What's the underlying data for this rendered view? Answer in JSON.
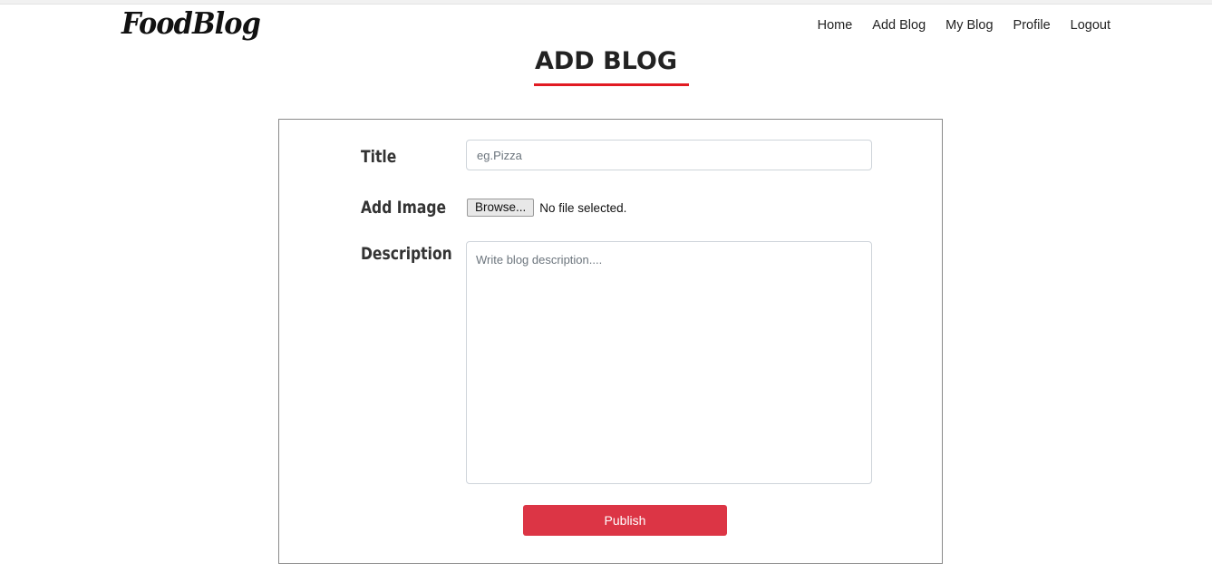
{
  "navbar": {
    "brand": "FoodBlog",
    "links": [
      "Home",
      "Add Blog",
      "My Blog",
      "Profile",
      "Logout"
    ]
  },
  "page": {
    "title": "ADD BLOG",
    "accent_color": "#e11b22"
  },
  "form": {
    "title_label": "Title",
    "title_placeholder": "eg.Pizza",
    "title_value": "",
    "image_label": "Add Image",
    "browse_label": "Browse...",
    "file_status": "No file selected.",
    "description_label": "Description",
    "description_placeholder": "Write blog description....",
    "description_value": "",
    "publish_label": "Publish",
    "publish_color": "#dc3545"
  }
}
